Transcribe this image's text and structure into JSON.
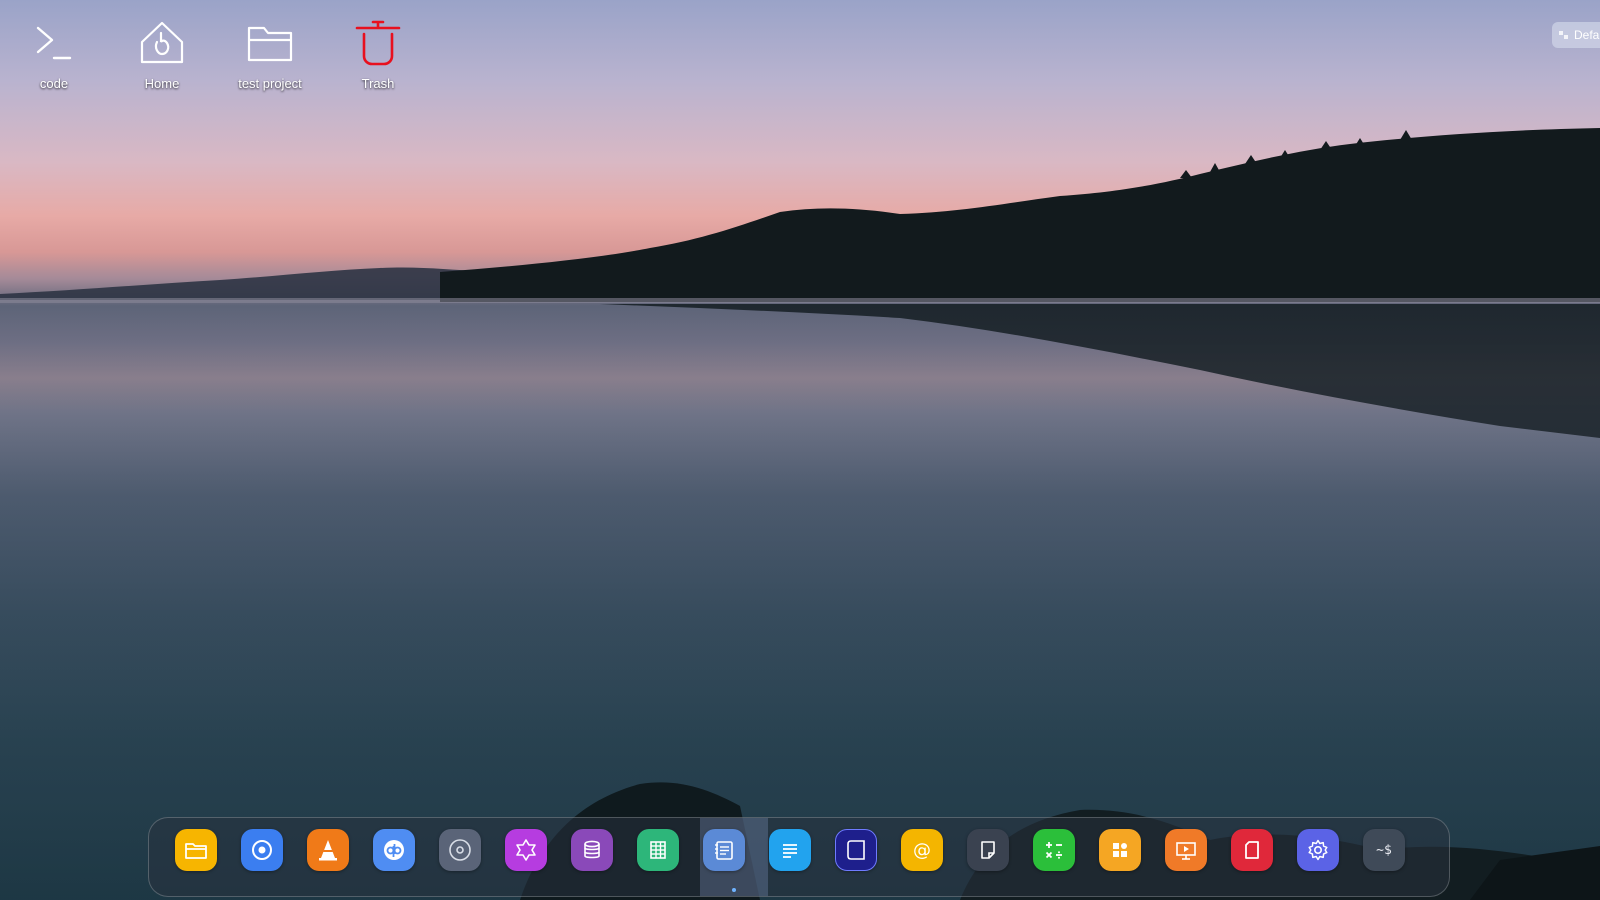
{
  "desktop": {
    "icons": [
      {
        "id": "code",
        "label": "code",
        "icon": "terminal-prompt-icon"
      },
      {
        "id": "home",
        "label": "Home",
        "icon": "home-folder-icon"
      },
      {
        "id": "test-project",
        "label": "test project",
        "icon": "folder-icon"
      },
      {
        "id": "trash",
        "label": "Trash",
        "icon": "trash-icon"
      }
    ]
  },
  "layout_indicator": {
    "text": "Defa"
  },
  "dock": {
    "items": [
      {
        "name": "file-manager",
        "icon": "folder-icon",
        "color": "#f7b500"
      },
      {
        "name": "chromium",
        "icon": "browser-icon",
        "color": "#3b7ef0"
      },
      {
        "name": "vlc",
        "icon": "traffic-cone-icon",
        "color": "#f07a18"
      },
      {
        "name": "qbittorrent",
        "icon": "qb-icon",
        "color": "#4f8df2"
      },
      {
        "name": "disc-burner",
        "icon": "disc-icon",
        "color": "#5a6478"
      },
      {
        "name": "app-store",
        "icon": "flower-icon",
        "color": "#b63ce0"
      },
      {
        "name": "database",
        "icon": "database-icon",
        "color": "#8a49b9"
      },
      {
        "name": "spreadsheet",
        "icon": "spreadsheet-icon",
        "color": "#2db67a"
      },
      {
        "name": "text-editor",
        "icon": "notepad-icon",
        "color": "#5b8ad6",
        "active": true
      },
      {
        "name": "document-writer",
        "icon": "lines-icon",
        "color": "#22a3ee"
      },
      {
        "name": "notes-app",
        "icon": "notebook-icon",
        "color": "#1e1f8c"
      },
      {
        "name": "email",
        "icon": "at-sign-icon",
        "color": "#f4b500"
      },
      {
        "name": "sticky-notes",
        "icon": "sticky-note-icon",
        "color": "#3a4250"
      },
      {
        "name": "calculator",
        "icon": "calculator-icon",
        "color": "#2bbf3a"
      },
      {
        "name": "app-launcher",
        "icon": "grid-shapes-icon",
        "color": "#f5a623"
      },
      {
        "name": "presentation",
        "icon": "presentation-icon",
        "color": "#f07a28"
      },
      {
        "name": "pdf-reader",
        "icon": "document-icon",
        "color": "#e0283a"
      },
      {
        "name": "settings",
        "icon": "gear-icon",
        "color": "#5b63e6"
      },
      {
        "name": "terminal",
        "icon": "terminal-icon",
        "label": "~$",
        "color": "#3f4a58"
      }
    ]
  }
}
